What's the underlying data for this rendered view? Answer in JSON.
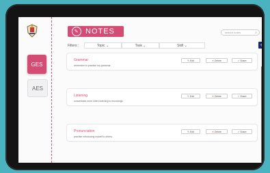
{
  "sidebar": {
    "crest_icon": "crest-icon",
    "tabs": [
      {
        "label": "GES",
        "active": true
      },
      {
        "label": "AES",
        "active": false
      }
    ]
  },
  "header": {
    "title": "NOTES",
    "title_icon": "note-icon",
    "search_placeholder": "search notes"
  },
  "filters": {
    "label": "Filters :",
    "items": [
      "Topic",
      "Task",
      "Skill"
    ]
  },
  "add_label": "+",
  "actions": {
    "edit": "Edit",
    "delete": "Delete",
    "share": "Share"
  },
  "notes": [
    {
      "title": "Grammar",
      "text": "remember to practice my grammar"
    },
    {
      "title": "Listening",
      "text": "concentrate more when listening to recordings"
    },
    {
      "title": "Pronunciation",
      "text": "practise introducing myself to others"
    }
  ],
  "colors": {
    "accent": "#d44b74",
    "primary": "#1a2b6b"
  }
}
